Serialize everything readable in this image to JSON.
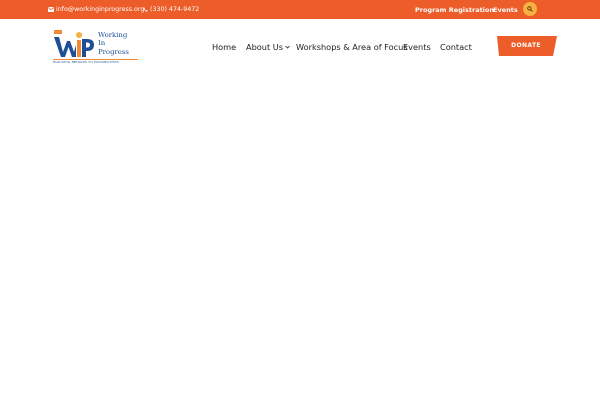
{
  "topbar": {
    "email": "info@workinginprogress.org",
    "phone": "(330) 474-9472",
    "links": [
      "Program Registration",
      "Events"
    ],
    "email_icon": "envelope-icon",
    "phone_icon": "phone-icon",
    "search_icon": "search-icon",
    "bg_color": "#ec5d2a",
    "search_color": "#f6b13e"
  },
  "logo": {
    "words": [
      "Working",
      "In",
      "Progress"
    ],
    "tagline": "BUILDING BRIDGES TO POSSIBILITIES"
  },
  "nav": {
    "items": [
      "Home",
      "About Us",
      "Workshops & Area of Focus",
      "Events",
      "Contact"
    ],
    "dropdown_icon": "chevron-down-icon"
  },
  "donate": {
    "label": "DONATE",
    "color": "#ec5d2a"
  }
}
